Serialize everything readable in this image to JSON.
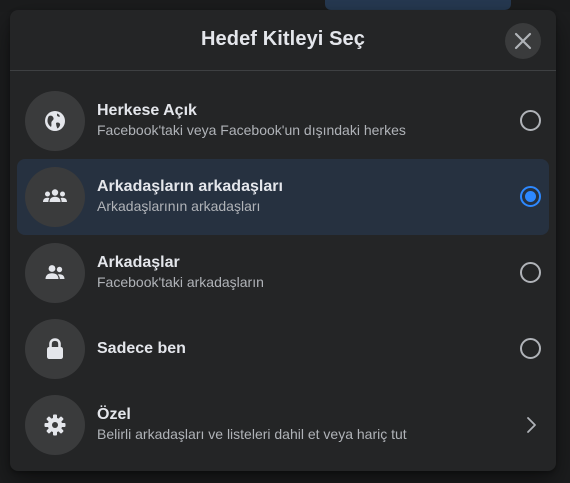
{
  "dialog": {
    "title": "Hedef Kitleyi Seç",
    "close_icon": "close-icon"
  },
  "options": [
    {
      "title": "Herkese Açık",
      "subtitle": "Facebook'taki veya Facebook'un dışındaki herkes",
      "icon": "globe-icon",
      "selected": false
    },
    {
      "title": "Arkadaşların arkadaşları",
      "subtitle": "Arkadaşlarının arkadaşları",
      "icon": "friends-of-friends-icon",
      "selected": true
    },
    {
      "title": "Arkadaşlar",
      "subtitle": "Facebook'taki arkadaşların",
      "icon": "friends-icon",
      "selected": false
    },
    {
      "title": "Sadece ben",
      "subtitle": "",
      "icon": "lock-icon",
      "selected": false
    },
    {
      "title": "Özel",
      "subtitle": "Belirli arkadaşları ve listeleri dahil et veya hariç tut",
      "icon": "gear-icon",
      "selected": false
    }
  ],
  "colors": {
    "accent": "#2d88ff",
    "dialog_bg": "#242526",
    "selected_row_bg": "#263140",
    "icon_circle_bg": "#3a3b3c",
    "primary_text": "#e4e6eb",
    "secondary_text": "#b0b3b8"
  }
}
